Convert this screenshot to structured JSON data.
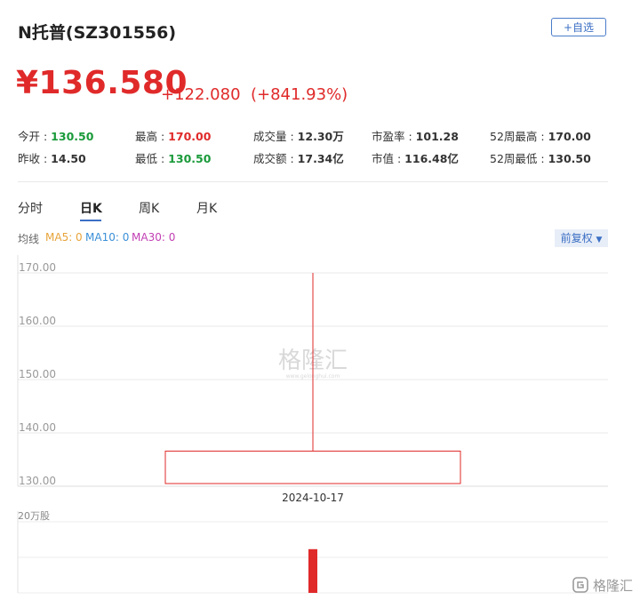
{
  "header": {
    "title": "N托普(SZ301556)",
    "watch_label": "+自选"
  },
  "quote": {
    "price": "¥136.580",
    "change": "+122.080",
    "change_pct": "(+841.93%)"
  },
  "stats": {
    "open_label": "今开 : ",
    "open": "130.50",
    "prev_close_label": "昨收 : ",
    "prev_close": "14.50",
    "high_label": "最高 : ",
    "high": "170.00",
    "low_label": "最低 : ",
    "low": "130.50",
    "volume_label": "成交量 : ",
    "volume": "12.30万",
    "amount_label": "成交额 : ",
    "amount": "17.34亿",
    "pe_label": "市盈率 : ",
    "pe": "101.28",
    "mcap_label": "市值 : ",
    "mcap": "116.48亿",
    "w52_high_label": "52周最高 : ",
    "w52_high": "170.00",
    "w52_low_label": "52周最低 : ",
    "w52_low": "130.50"
  },
  "tabs": [
    "分时",
    "日K",
    "周K",
    "月K"
  ],
  "active_tab": "日K",
  "ma": {
    "label": "均线",
    "ma5": "MA5: 0",
    "ma10": "MA10: 0",
    "ma30": "MA30: 0",
    "ma5_color": "#e8a33a",
    "ma10_color": "#3b8fd8",
    "ma30_color": "#c23fb4"
  },
  "adjust_label": "前复权",
  "watermark": "格隆汇",
  "watermark_url": "www.gelonghui.com",
  "brand": "格隆汇",
  "colors": {
    "up": "#e02a2a",
    "link": "#3b6fc4",
    "grid": "#e8e8e8"
  },
  "chart_data": {
    "type": "candlestick",
    "y_ticks": [
      "170.00",
      "160.00",
      "150.00",
      "140.00",
      "130.00"
    ],
    "ylim": [
      130,
      170
    ],
    "candles": [
      {
        "date": "2024-10-17",
        "open": 130.5,
        "close": 136.58,
        "high": 170.0,
        "low": 130.5
      }
    ],
    "volume": {
      "label": "20万股",
      "ymax": 200000,
      "values": [
        123000
      ]
    }
  }
}
